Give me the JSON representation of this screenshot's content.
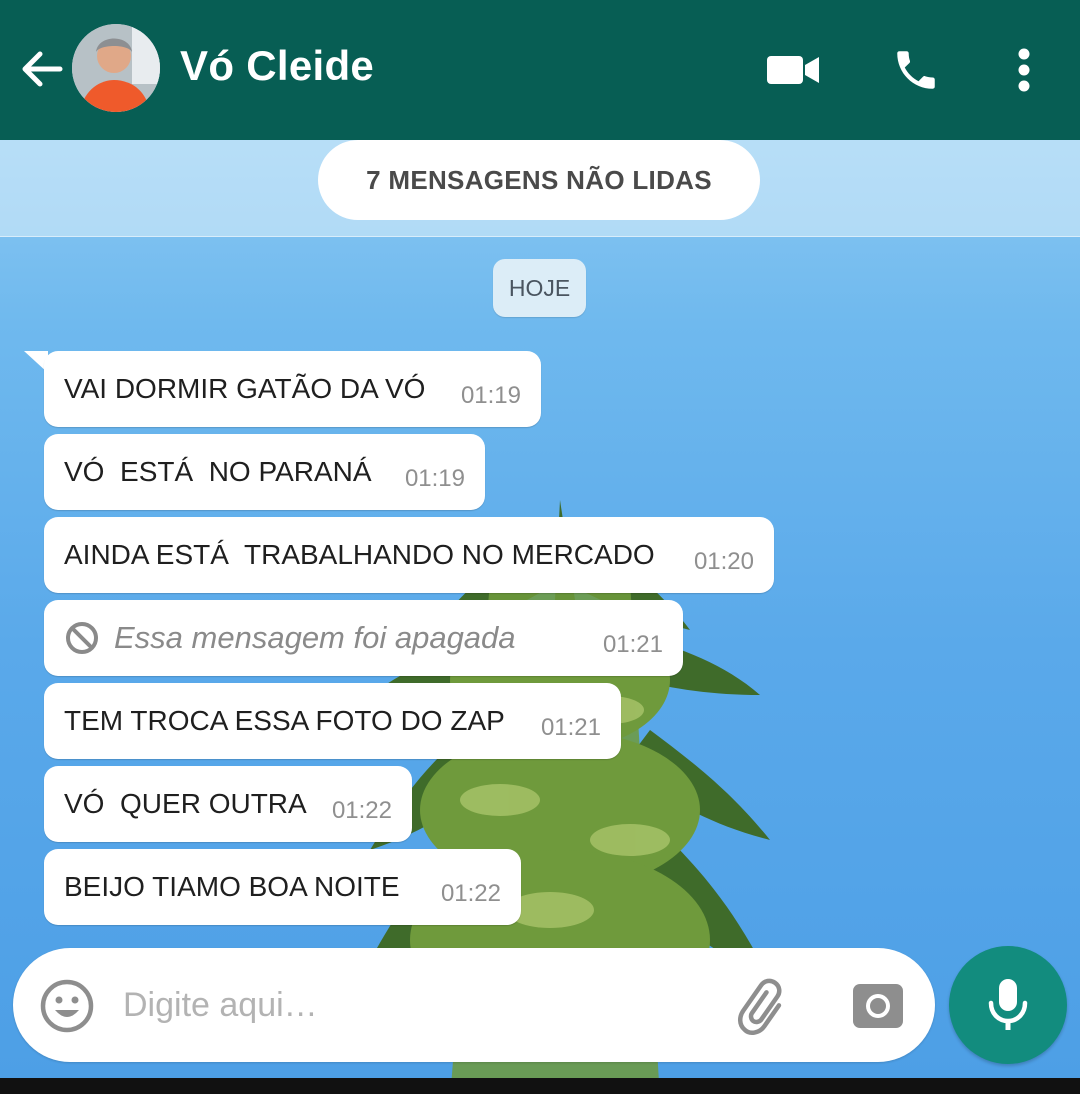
{
  "header": {
    "contact_name": "Vó Cleide",
    "icons": [
      "back-arrow-icon",
      "video-call-icon",
      "voice-call-icon",
      "more-options-icon"
    ]
  },
  "unread_banner": "7 MENSAGENS NÃO LIDAS",
  "date_label": "HOJE",
  "messages": [
    {
      "text": "VAI DORMIR GATÃO DA VÓ",
      "time": "01:19"
    },
    {
      "text": "VÓ  ESTÁ  NO PARANÁ",
      "time": "01:19"
    },
    {
      "text": "AINDA ESTÁ  TRABALHANDO NO MERCADO",
      "time": "01:20"
    },
    {
      "text": "Essa mensagem foi apagada",
      "time": "01:21",
      "deleted": true
    },
    {
      "text": "TEM TROCA ESSA FOTO DO ZAP",
      "time": "01:21"
    },
    {
      "text": "VÓ  QUER OUTRA",
      "time": "01:22"
    },
    {
      "text": "BEIJO TIAMO BOA NOITE",
      "time": "01:22"
    }
  ],
  "composer": {
    "placeholder": "Digite aqui…",
    "icons": [
      "emoji-icon",
      "attach-icon",
      "camera-icon",
      "microphone-icon"
    ]
  },
  "colors": {
    "header": "#075e54",
    "mic_button": "#128c7e",
    "bubble": "#ffffff"
  }
}
